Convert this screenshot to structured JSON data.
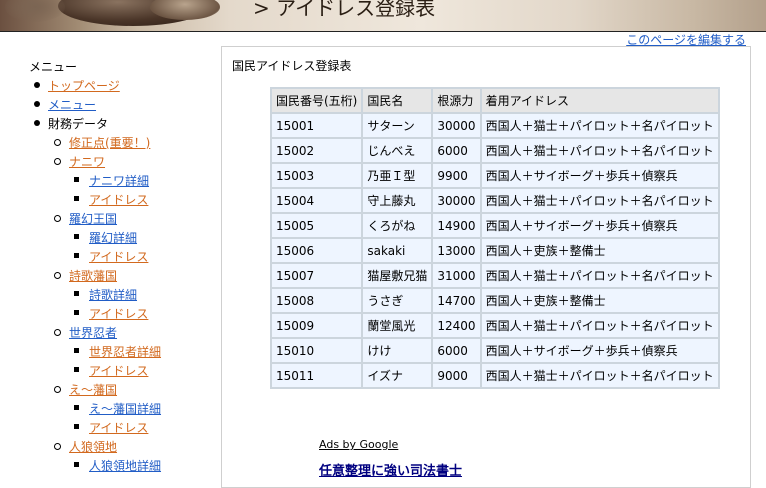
{
  "header": {
    "title": "> アイドレス登録表",
    "edit_link": "このページを編集する"
  },
  "menu": {
    "title": "メニュー",
    "items": [
      {
        "label": "トップページ",
        "level": 1,
        "link": true,
        "visited": true
      },
      {
        "label": "メニュー",
        "level": 1,
        "link": true,
        "visited": false
      },
      {
        "label": "財務データ",
        "level": 1,
        "link": false,
        "visited": false
      },
      {
        "label": "修正点(重要！)",
        "level": 2,
        "link": true,
        "visited": true
      },
      {
        "label": "ナニワ",
        "level": 2,
        "link": true,
        "visited": true
      },
      {
        "label": "ナニワ詳細",
        "level": 3,
        "link": true,
        "visited": false
      },
      {
        "label": "アイドレス",
        "level": 3,
        "link": true,
        "visited": true
      },
      {
        "label": "羅幻王国",
        "level": 2,
        "link": true,
        "visited": false
      },
      {
        "label": "羅幻詳細",
        "level": 3,
        "link": true,
        "visited": false
      },
      {
        "label": "アイドレス",
        "level": 3,
        "link": true,
        "visited": true
      },
      {
        "label": "詩歌藩国",
        "level": 2,
        "link": true,
        "visited": true
      },
      {
        "label": "詩歌詳細",
        "level": 3,
        "link": true,
        "visited": false
      },
      {
        "label": "アイドレス",
        "level": 3,
        "link": true,
        "visited": true
      },
      {
        "label": "世界忍者",
        "level": 2,
        "link": true,
        "visited": false
      },
      {
        "label": "世界忍者詳細",
        "level": 3,
        "link": true,
        "visited": true
      },
      {
        "label": "アイドレス",
        "level": 3,
        "link": true,
        "visited": true
      },
      {
        "label": "え～藩国",
        "level": 2,
        "link": true,
        "visited": true
      },
      {
        "label": "え～藩国詳細",
        "level": 3,
        "link": true,
        "visited": false
      },
      {
        "label": "アイドレス",
        "level": 3,
        "link": true,
        "visited": true
      },
      {
        "label": "人狼領地",
        "level": 2,
        "link": true,
        "visited": true
      },
      {
        "label": "人狼領地詳細",
        "level": 3,
        "link": true,
        "visited": false
      }
    ]
  },
  "content": {
    "title": "国民アイドレス登録表",
    "headers": [
      "国民番号(五桁)",
      "国民名",
      "根源力",
      "着用アイドレス"
    ],
    "rows": [
      [
        "15001",
        "サターン",
        "30000",
        "西国人＋猫士＋パイロット＋名パイロット"
      ],
      [
        "15002",
        "じんべえ",
        "6000",
        "西国人＋猫士＋パイロット＋名パイロット"
      ],
      [
        "15003",
        "乃亜Ｉ型",
        "9900",
        "西国人＋サイボーグ＋歩兵＋偵察兵"
      ],
      [
        "15004",
        "守上藤丸",
        "30000",
        "西国人＋猫士＋パイロット＋名パイロット"
      ],
      [
        "15005",
        "くろがね",
        "14900",
        "西国人＋サイボーグ＋歩兵＋偵察兵"
      ],
      [
        "15006",
        "sakaki",
        "13000",
        "西国人＋吏族＋整備士"
      ],
      [
        "15007",
        "猫屋敷兄猫",
        "31000",
        "西国人＋猫士＋パイロット＋名パイロット"
      ],
      [
        "15008",
        "うさぎ",
        "14700",
        "西国人＋吏族＋整備士"
      ],
      [
        "15009",
        "蘭堂風光",
        "12400",
        "西国人＋猫士＋パイロット＋名パイロット"
      ],
      [
        "15010",
        "けけ",
        "6000",
        "西国人＋サイボーグ＋歩兵＋偵察兵"
      ],
      [
        "15011",
        "イズナ",
        "9000",
        "西国人＋猫士＋パイロット＋名パイロット"
      ]
    ],
    "ads_label": "Ads by Google",
    "ad_title": "任意整理に強い司法書士"
  }
}
